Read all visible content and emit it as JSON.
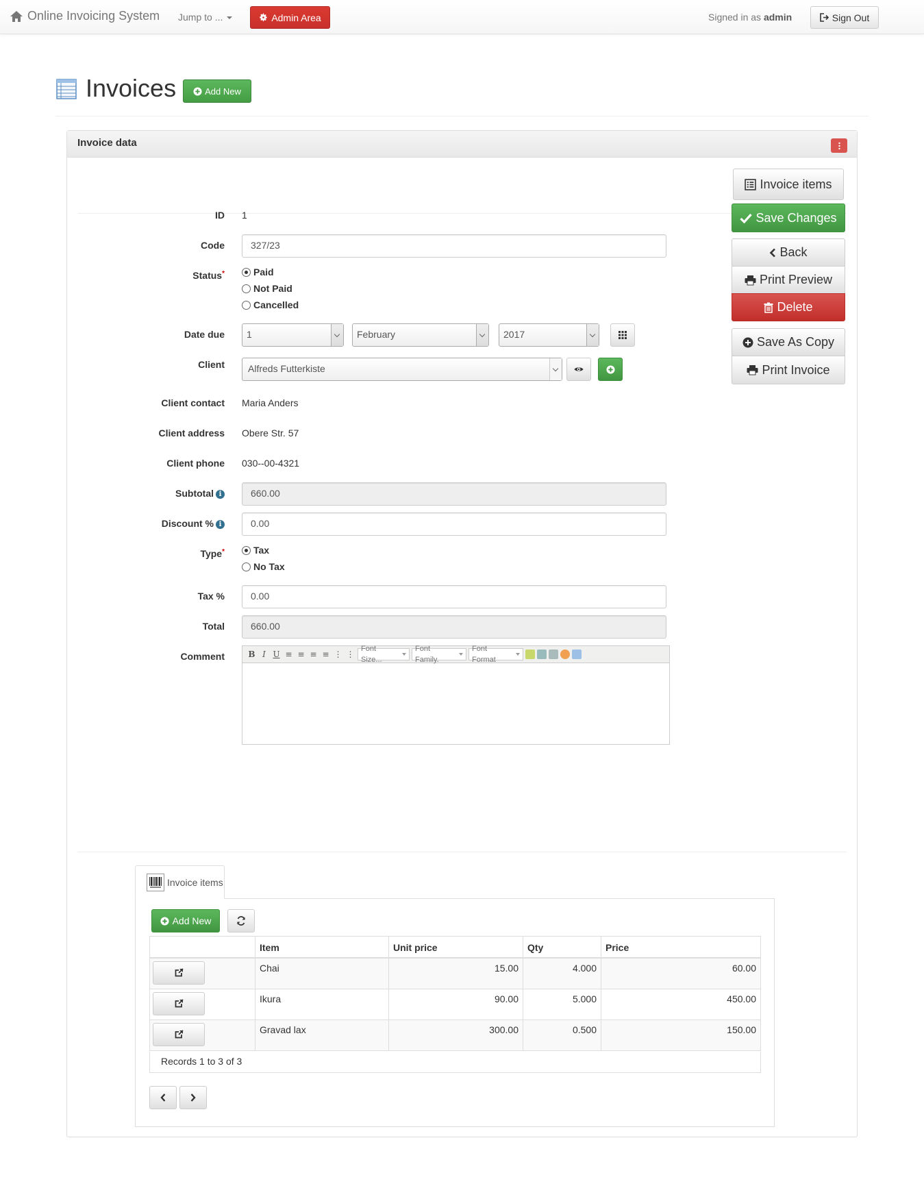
{
  "navbar": {
    "brand": "Online Invoicing System",
    "jump_to": "Jump to ...",
    "admin_area": "Admin Area",
    "signed_in_prefix": "Signed in as",
    "signed_in_user": "admin",
    "sign_out": "Sign Out"
  },
  "page": {
    "title": "Invoices",
    "add_new": "Add New"
  },
  "panel": {
    "heading": "Invoice data",
    "invoice_items_button": "Invoice items"
  },
  "form": {
    "id": {
      "label": "ID",
      "value": "1"
    },
    "code": {
      "label": "Code",
      "value": "327/23"
    },
    "status": {
      "label": "Status",
      "required": "*",
      "options": [
        "Paid",
        "Not Paid",
        "Cancelled"
      ],
      "selected": "Paid"
    },
    "date_due": {
      "label": "Date due",
      "day": "1",
      "month": "February",
      "year": "2017"
    },
    "client": {
      "label": "Client",
      "value": "Alfreds Futterkiste"
    },
    "client_contact": {
      "label": "Client contact",
      "value": "Maria Anders"
    },
    "client_address": {
      "label": "Client address",
      "value": "Obere Str. 57"
    },
    "client_phone": {
      "label": "Client phone",
      "value": "030--00-4321"
    },
    "subtotal": {
      "label": "Subtotal",
      "value": "660.00"
    },
    "discount": {
      "label": "Discount %",
      "value": "0.00"
    },
    "type": {
      "label": "Type",
      "required": "*",
      "options": [
        "Tax",
        "No Tax"
      ],
      "selected": "Tax"
    },
    "tax": {
      "label": "Tax %",
      "value": "0.00"
    },
    "total": {
      "label": "Total",
      "value": "660.00"
    },
    "comment": {
      "label": "Comment",
      "value": ""
    }
  },
  "editor_toolbar": {
    "font_size": "Font Size...",
    "font_family": "Font Family.",
    "font_format": "Font Format"
  },
  "actions": {
    "save_changes": "Save Changes",
    "back": "Back",
    "print_preview": "Print Preview",
    "delete": "Delete",
    "save_as_copy": "Save As Copy",
    "print_invoice": "Print Invoice"
  },
  "child": {
    "tab_label": "Invoice items",
    "add_new": "Add New",
    "columns": [
      "Item",
      "Unit price",
      "Qty",
      "Price"
    ],
    "rows": [
      {
        "item": "Chai",
        "unit_price": "15.00",
        "qty": "4.000",
        "price": "60.00"
      },
      {
        "item": "Ikura",
        "unit_price": "90.00",
        "qty": "5.000",
        "price": "450.00"
      },
      {
        "item": "Gravad lax",
        "unit_price": "300.00",
        "qty": "0.500",
        "price": "150.00"
      }
    ],
    "records": "Records 1 to 3 of 3"
  },
  "colors": {
    "danger": "#d9534f",
    "success": "#5cb85c"
  }
}
